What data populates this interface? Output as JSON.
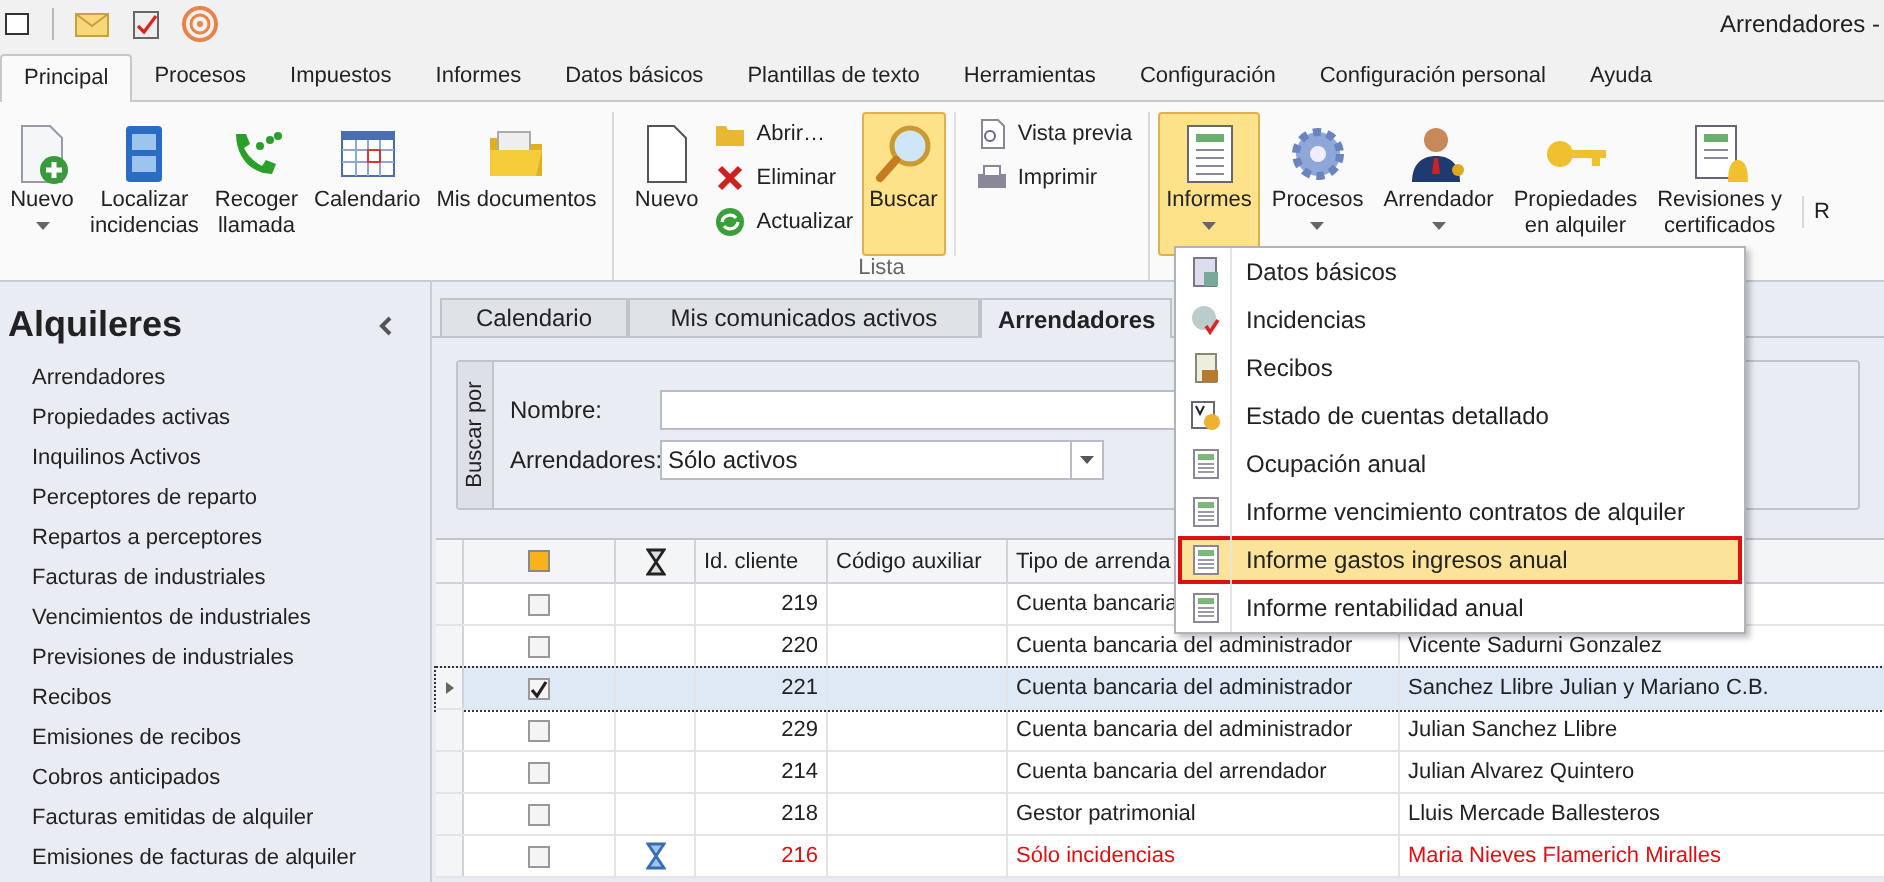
{
  "window": {
    "title": "Arrendadores -"
  },
  "ribbon_tabs": [
    {
      "label": "Principal",
      "selected": true
    },
    {
      "label": "Procesos",
      "selected": false
    },
    {
      "label": "Impuestos",
      "selected": false
    },
    {
      "label": "Informes",
      "selected": false
    },
    {
      "label": "Datos básicos",
      "selected": false
    },
    {
      "label": "Plantillas de texto",
      "selected": false
    },
    {
      "label": "Herramientas",
      "selected": false
    },
    {
      "label": "Configuración",
      "selected": false
    },
    {
      "label": "Configuración personal",
      "selected": false
    },
    {
      "label": "Ayuda",
      "selected": false
    }
  ],
  "ribbon": {
    "large_left": [
      {
        "lines": [
          "Nuevo"
        ],
        "kind": "newdoc",
        "dropdown": true,
        "selected": false
      },
      {
        "lines": [
          "Localizar",
          "incidencias"
        ],
        "kind": "cabinet",
        "dropdown": false,
        "selected": false
      },
      {
        "lines": [
          "Recoger",
          "llamada"
        ],
        "kind": "phone",
        "dropdown": false,
        "selected": false
      },
      {
        "lines": [
          "Calendario"
        ],
        "kind": "calendar",
        "dropdown": false,
        "selected": false
      },
      {
        "lines": [
          "Mis documentos"
        ],
        "kind": "folder",
        "dropdown": false,
        "selected": false
      }
    ],
    "lista": {
      "label": "Lista",
      "new": {
        "lines": [
          "Nuevo"
        ],
        "kind": "page",
        "dropdown": false,
        "selected": false
      },
      "small": [
        {
          "label": "Abrir…",
          "kind": "open"
        },
        {
          "label": "Eliminar",
          "kind": "delete"
        },
        {
          "label": "Actualizar",
          "kind": "refresh"
        }
      ],
      "search": {
        "lines": [
          "Buscar"
        ],
        "kind": "search",
        "dropdown": false,
        "selected": true
      },
      "small2": [
        {
          "label": "Vista previa",
          "kind": "preview"
        },
        {
          "label": "Imprimir",
          "kind": "print"
        }
      ]
    },
    "large_right": [
      {
        "lines": [
          "Informes"
        ],
        "kind": "report",
        "dropdown": true,
        "selected": true
      },
      {
        "lines": [
          "Procesos"
        ],
        "kind": "gear",
        "dropdown": true,
        "selected": false
      },
      {
        "lines": [
          "Arrendador"
        ],
        "kind": "person",
        "dropdown": true,
        "selected": false
      },
      {
        "lines": [
          "Propiedades",
          "en alquiler"
        ],
        "kind": "key",
        "dropdown": false,
        "selected": false
      },
      {
        "lines": [
          "Revisiones y",
          "certificados"
        ],
        "kind": "bell",
        "dropdown": false,
        "selected": false
      }
    ],
    "cut_label": "R"
  },
  "sidebar": {
    "title": "Alquileres",
    "items": [
      "Arrendadores",
      "Propiedades activas",
      "Inquilinos Activos",
      "Perceptores de reparto",
      "Repartos a perceptores",
      "Facturas de industriales",
      "Vencimientos de industriales",
      "Previsiones de industriales",
      "Recibos",
      "Emisiones de recibos",
      "Cobros anticipados",
      "Facturas emitidas de alquiler",
      "Emisiones de facturas de alquiler"
    ]
  },
  "doc_tabs": [
    {
      "label": "Calendario",
      "selected": false
    },
    {
      "label": "Mis comunicados activos",
      "selected": false
    },
    {
      "label": "Arrendadores",
      "selected": true
    }
  ],
  "search_panel": {
    "caption": "Buscar por",
    "name_label": "Nombre:",
    "filter_label": "Arrendadores:",
    "filter_value": "Sólo activos"
  },
  "table": {
    "select_all_partial": true,
    "columns": [
      "Id. cliente",
      "Código auxiliar",
      "Tipo de arrenda"
    ],
    "rows": [
      {
        "checked": false,
        "pending": false,
        "current": false,
        "alert": false,
        "id": "219",
        "type": "Cuenta bancaria"
      },
      {
        "checked": false,
        "pending": false,
        "current": false,
        "alert": false,
        "id": "220",
        "type": "Cuenta bancaria del administrador",
        "name": "Vicente Sadurni Gonzalez"
      },
      {
        "checked": true,
        "pending": false,
        "current": true,
        "alert": false,
        "id": "221",
        "type": "Cuenta bancaria del administrador",
        "name": "Sanchez Llibre Julian y Mariano C.B."
      },
      {
        "checked": false,
        "pending": false,
        "current": false,
        "alert": false,
        "id": "229",
        "type": "Cuenta bancaria del administrador",
        "name": "Julian Sanchez Llibre"
      },
      {
        "checked": false,
        "pending": false,
        "current": false,
        "alert": false,
        "id": "214",
        "type": "Cuenta bancaria del arrendador",
        "name": "Julian Alvarez Quintero"
      },
      {
        "checked": false,
        "pending": false,
        "current": false,
        "alert": false,
        "id": "218",
        "type": "Gestor patrimonial",
        "name": "Lluis Mercade Ballesteros"
      },
      {
        "checked": false,
        "pending": true,
        "current": false,
        "alert": true,
        "id": "216",
        "type": "Sólo incidencias",
        "name": "Maria Nieves Flamerich Miralles"
      }
    ]
  },
  "menu": {
    "items": [
      {
        "label": "Datos básicos",
        "kind": "data",
        "selected": false
      },
      {
        "label": "Incidencias",
        "kind": "incident",
        "selected": false
      },
      {
        "label": "Recibos",
        "kind": "receipt",
        "selected": false
      },
      {
        "label": "Estado de cuentas detallado",
        "kind": "account",
        "selected": false
      },
      {
        "label": "Ocupación anual",
        "kind": "sheet",
        "selected": false
      },
      {
        "label": "Informe vencimiento contratos de alquiler",
        "kind": "sheet",
        "selected": false
      },
      {
        "label": "Informe gastos ingresos anual",
        "kind": "sheet",
        "selected": true
      },
      {
        "label": "Informe rentabilidad anual",
        "kind": "sheet",
        "selected": false
      }
    ]
  }
}
